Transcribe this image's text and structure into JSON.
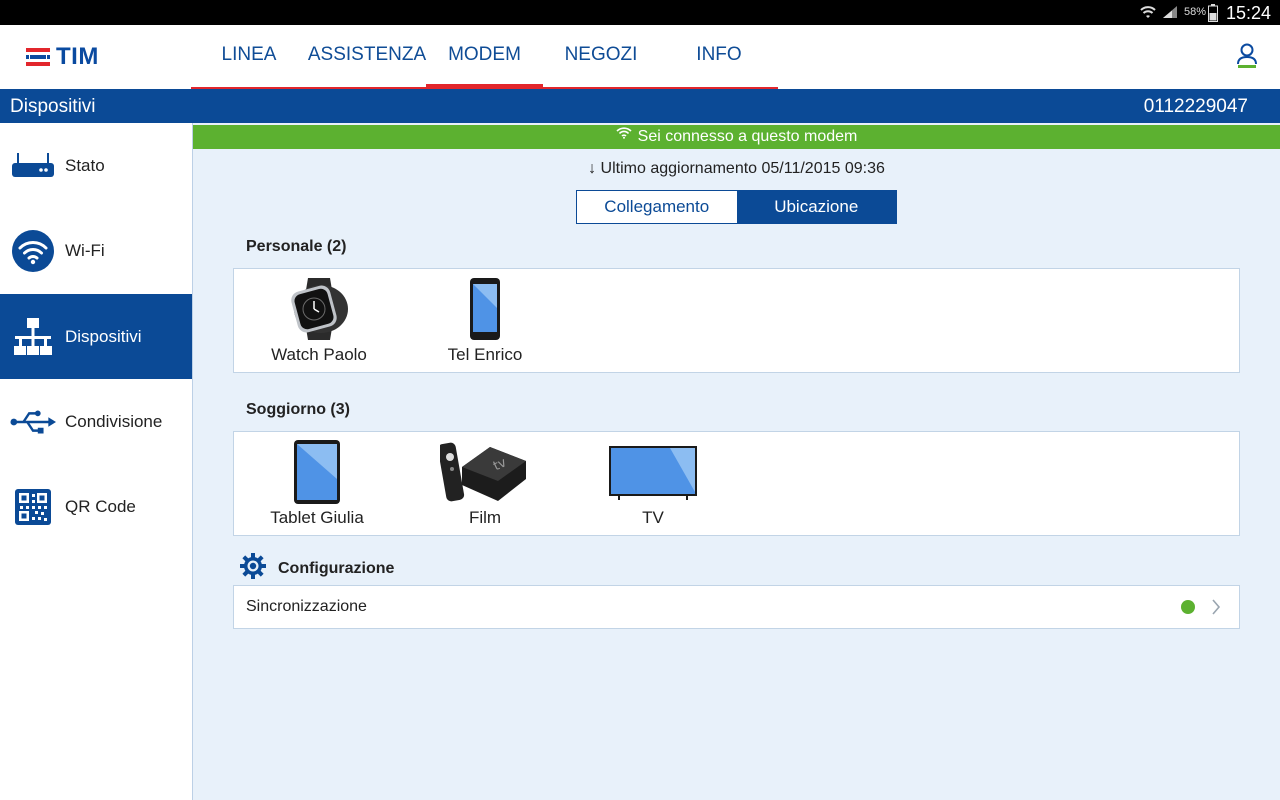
{
  "status_bar": {
    "battery": "58%",
    "time": "15:24"
  },
  "header": {
    "logo_text": "TIM",
    "nav": [
      {
        "label": "LINEA"
      },
      {
        "label": "ASSISTENZA"
      },
      {
        "label": "MODEM",
        "active": true
      },
      {
        "label": "NEGOZI"
      },
      {
        "label": "INFO"
      }
    ]
  },
  "titlebar": {
    "title": "Dispositivi",
    "number": "0112229047"
  },
  "sidebar": {
    "items": [
      {
        "label": "Stato",
        "icon": "router-icon"
      },
      {
        "label": "Wi-Fi",
        "icon": "wifi-icon"
      },
      {
        "label": "Dispositivi",
        "icon": "network-icon",
        "active": true
      },
      {
        "label": "Condivisione",
        "icon": "usb-icon"
      },
      {
        "label": "QR Code",
        "icon": "qr-code-icon"
      }
    ]
  },
  "main": {
    "connected_text": "Sei connesso a questo modem",
    "updated_text": "↓ Ultimo aggiornamento 05/11/2015 09:36",
    "segments": {
      "collegamento": "Collegamento",
      "ubicazione": "Ubicazione"
    },
    "groups": [
      {
        "title": "Personale (2)",
        "devices": [
          {
            "label": "Watch Paolo",
            "icon": "smartwatch-icon"
          },
          {
            "label": "Tel Enrico",
            "icon": "phone-icon"
          }
        ]
      },
      {
        "title": "Soggiorno (3)",
        "devices": [
          {
            "label": "Tablet Giulia",
            "icon": "tablet-icon"
          },
          {
            "label": "Film",
            "icon": "tv-box-icon"
          },
          {
            "label": "TV",
            "icon": "television-icon"
          }
        ]
      }
    ],
    "config": {
      "title": "Configurazione",
      "sync_label": "Sincronizzazione",
      "sync_status_color": "#5cb130"
    }
  },
  "colors": {
    "brand_blue": "#0b4a96",
    "accent_red": "#e2262c",
    "connected_green": "#5cb130",
    "content_bg": "#e8f1fa"
  }
}
